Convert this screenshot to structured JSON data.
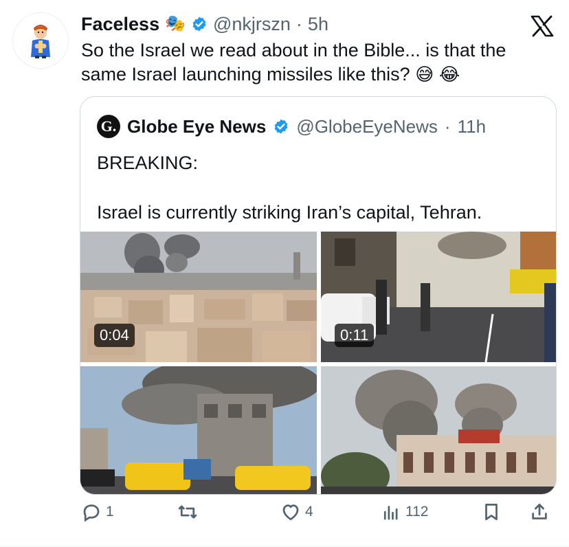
{
  "author": {
    "display_name": "Faceless",
    "name_emoji": "🎭",
    "handle": "@nkjrszn",
    "separator": "·",
    "time": "5h",
    "verified_icon": "verified-badge-icon"
  },
  "tweet": {
    "text": "So the Israel we read about in the Bible... is that the same Israel launching missiles like this?",
    "emojis": [
      "😅",
      "😂"
    ]
  },
  "quote": {
    "logo_letter": "G.",
    "display_name": "Globe Eye News",
    "handle": "@GlobeEyeNews",
    "separator": "·",
    "time": "11h",
    "text_line1": "BREAKING:",
    "text_line2": "Israel is currently striking Iran’s capital, Tehran.",
    "media": [
      {
        "type": "video",
        "duration": "0:04"
      },
      {
        "type": "video",
        "duration": "0:11"
      },
      {
        "type": "image"
      },
      {
        "type": "image"
      }
    ]
  },
  "actions": {
    "replies": "1",
    "retweets": "",
    "likes": "4",
    "views": "112"
  },
  "colors": {
    "text": "#0f1419",
    "secondary": "#536471",
    "verified": "#1d9bf0",
    "border": "#cfd9de"
  }
}
